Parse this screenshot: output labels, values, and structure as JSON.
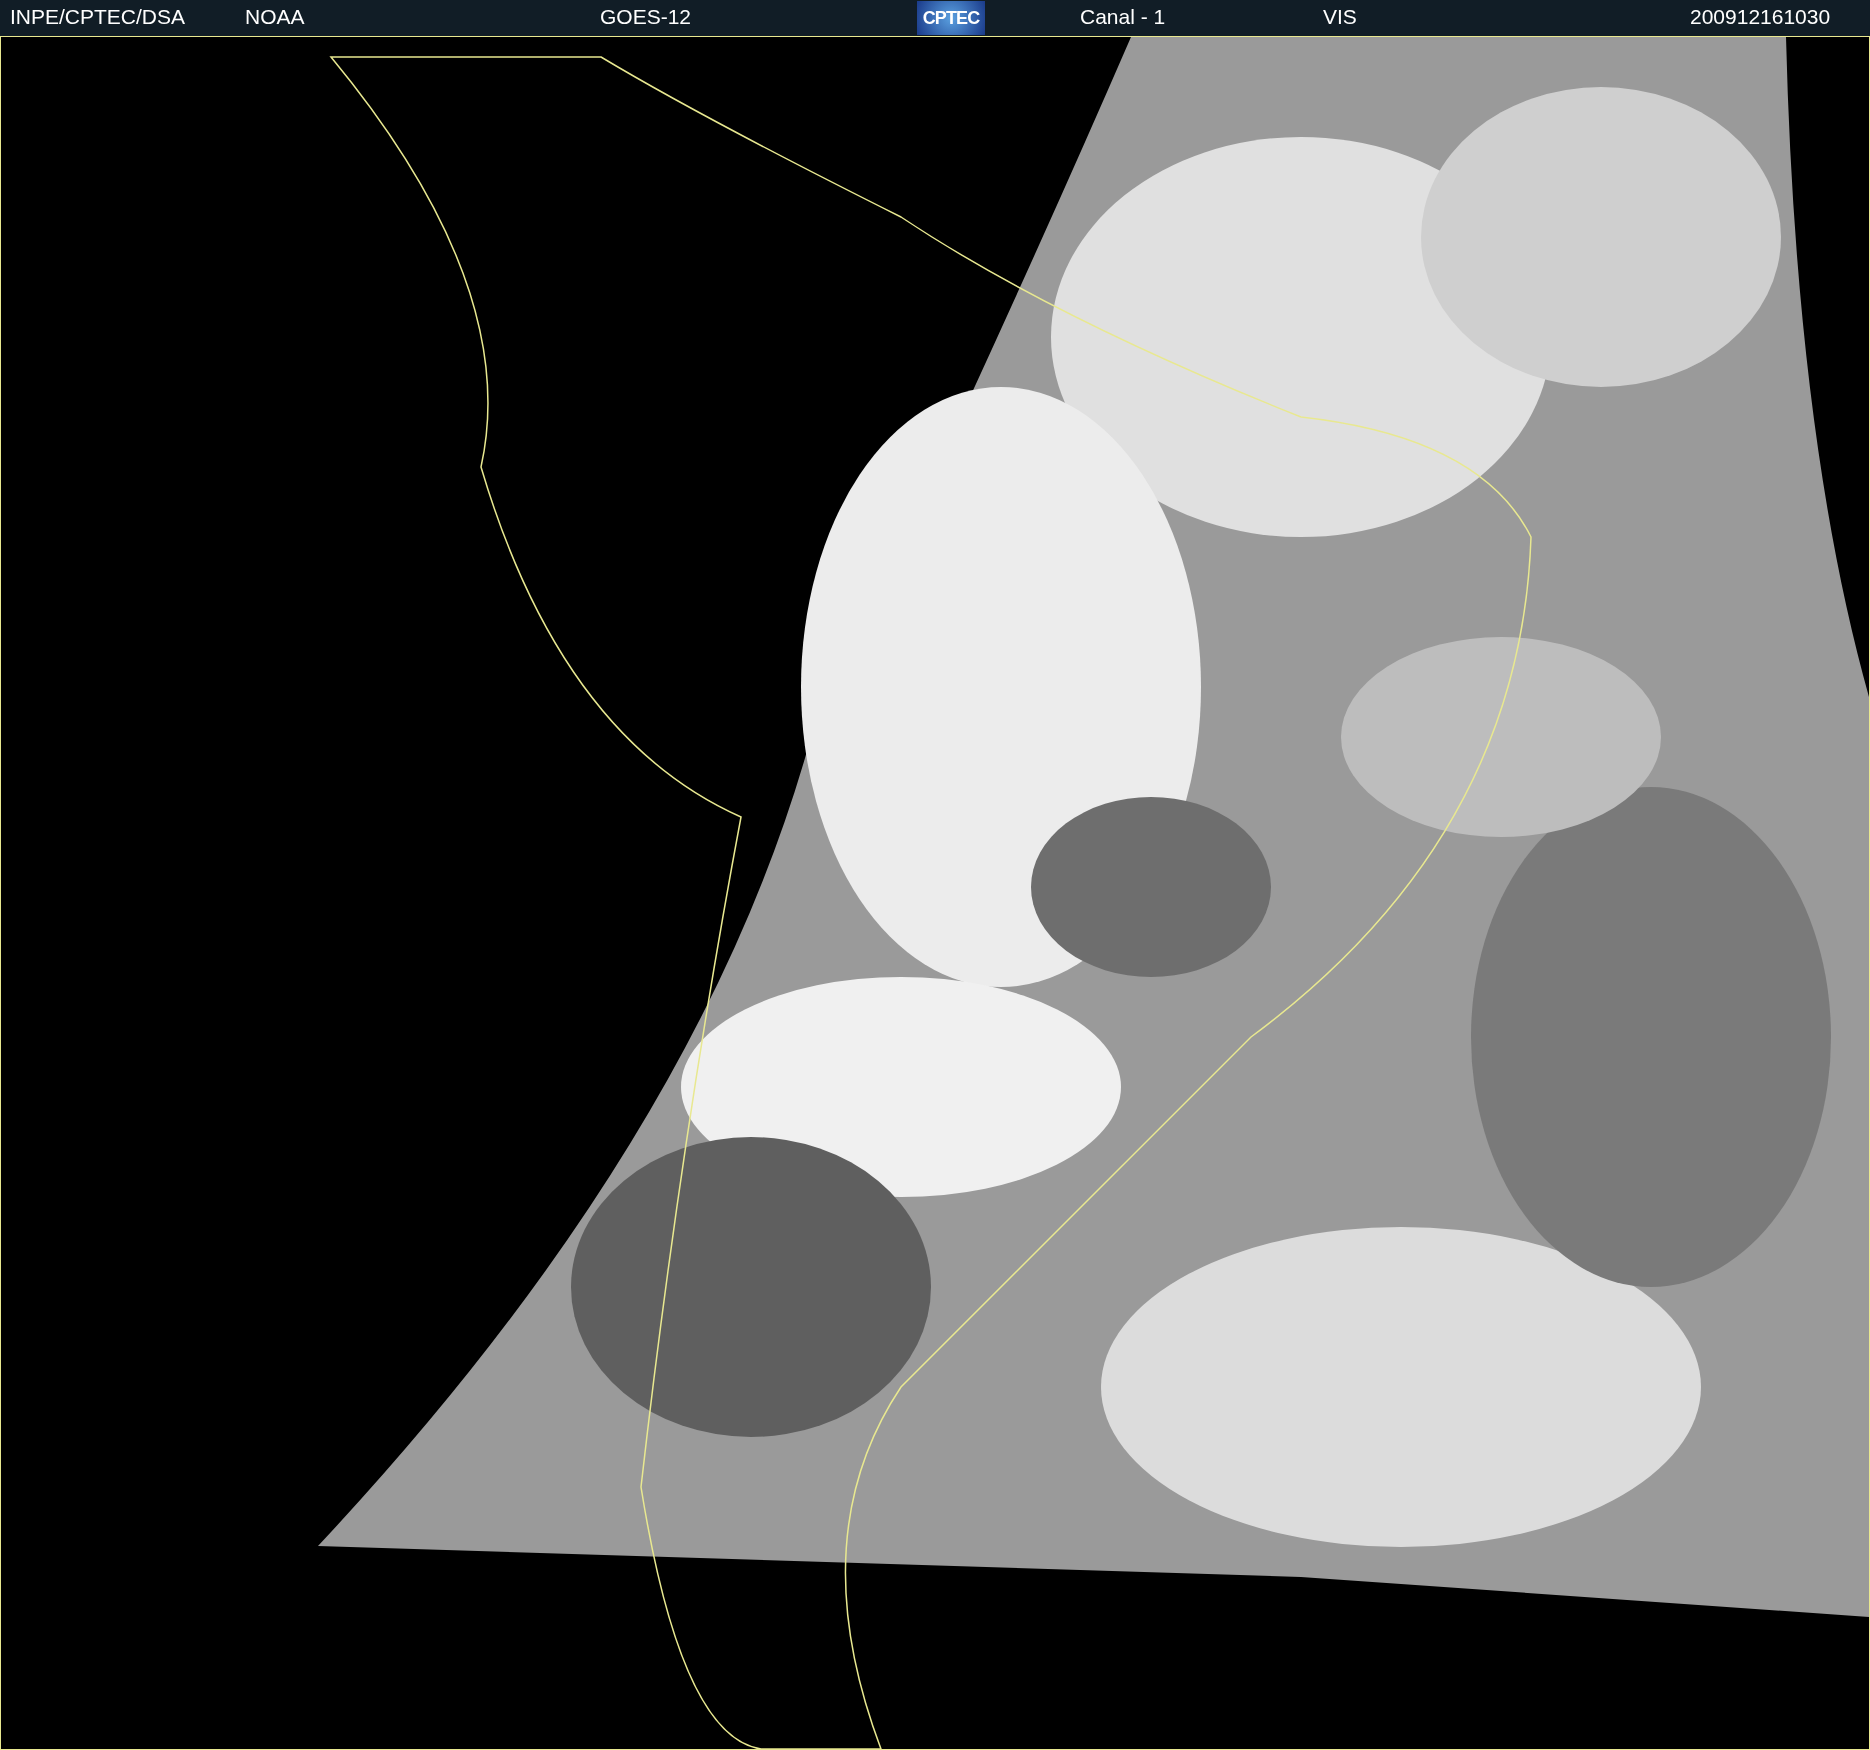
{
  "header": {
    "source": "INPE/CPTEC/DSA",
    "agency": "NOAA",
    "satellite": "GOES-12",
    "logo": "CPTEC",
    "channel": "Canal - 1",
    "band": "VIS",
    "timestamp": "200912161030"
  }
}
